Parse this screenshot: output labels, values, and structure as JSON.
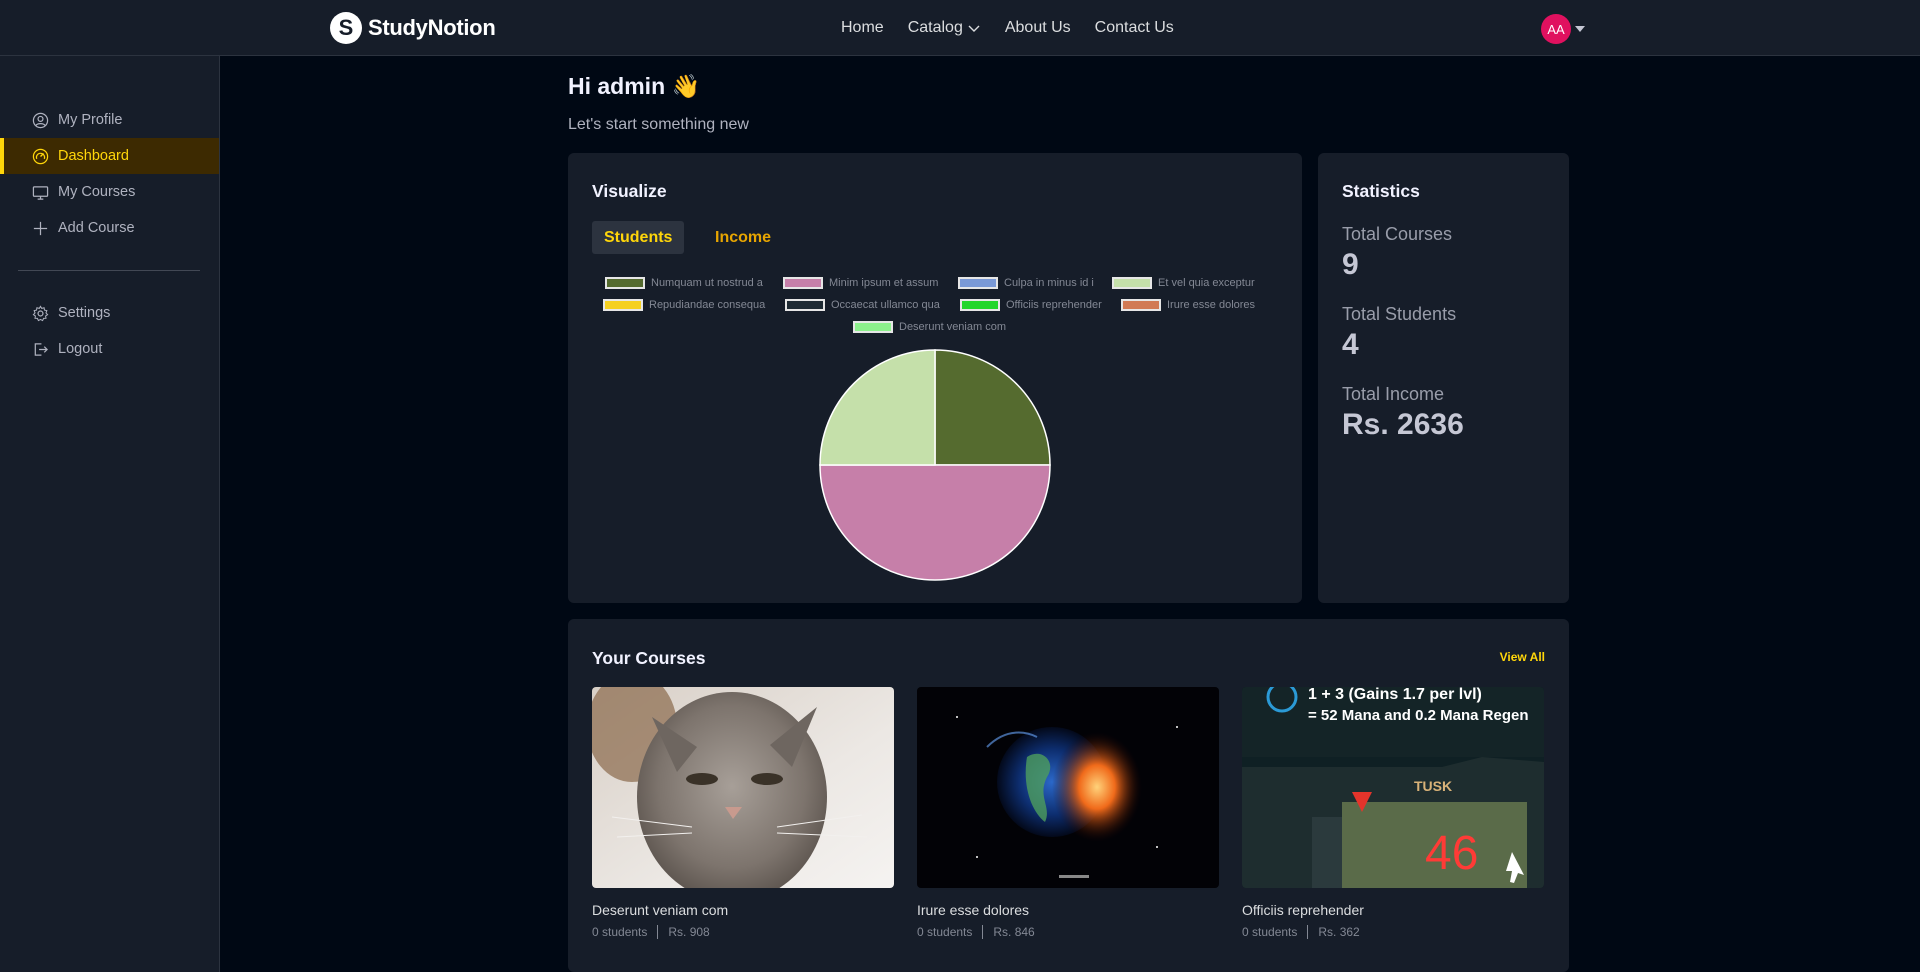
{
  "brand": {
    "name": "StudyNotion",
    "mark": "S"
  },
  "nav": {
    "links": [
      "Home",
      "Catalog",
      "About Us",
      "Contact Us"
    ],
    "avatar_initials": "AA"
  },
  "sidebar": {
    "items": [
      {
        "label": "My Profile",
        "icon": "user-circle-icon"
      },
      {
        "label": "Dashboard",
        "icon": "dashboard-gauge-icon",
        "active": true
      },
      {
        "label": "My Courses",
        "icon": "monitor-icon"
      },
      {
        "label": "Add Course",
        "icon": "plus-icon"
      }
    ],
    "bottom_items": [
      {
        "label": "Settings",
        "icon": "gear-icon"
      },
      {
        "label": "Logout",
        "icon": "logout-icon"
      }
    ]
  },
  "header": {
    "greeting": "Hi admin 👋",
    "subtitle": "Let's start something new"
  },
  "visualize": {
    "title": "Visualize",
    "tabs": [
      "Students",
      "Income"
    ],
    "selected_tab": "Students"
  },
  "chart_data": {
    "type": "pie",
    "categories": [
      "Numquam ut nostrud a",
      "Minim ipsum et assum",
      "Culpa in minus id i",
      "Et vel quia exceptur",
      "Repudiandae consequa",
      "Occaecat ullamco qua",
      "Officiis reprehender",
      "Irure esse dolores",
      "Deserunt veniam com"
    ],
    "values": [
      1,
      2,
      0,
      1,
      0,
      0,
      0,
      0,
      0
    ],
    "colors": [
      "#556b2f",
      "#c67fa9",
      "#7a99d6",
      "#c5e0aa",
      "#f5d020",
      "#1e2a33",
      "#22d62a",
      "#d17a55",
      "#8cf08c"
    ],
    "legend_position": "top"
  },
  "statistics": {
    "title": "Statistics",
    "items": [
      {
        "label": "Total Courses",
        "value": "9"
      },
      {
        "label": "Total Students",
        "value": "4"
      },
      {
        "label": "Total Income",
        "value": "Rs. 2636"
      }
    ]
  },
  "courses": {
    "title": "Your Courses",
    "view_all": "View All",
    "items": [
      {
        "name": "Deserunt veniam com",
        "students": "0 students",
        "price": "Rs. 908"
      },
      {
        "name": "Irure esse dolores",
        "students": "0 students",
        "price": "Rs. 846"
      },
      {
        "name": "Officiis reprehender",
        "students": "0 students",
        "price": "Rs. 362"
      }
    ],
    "thumb3_text": {
      "line1": "1 + 3  (Gains 1.7 per lvl)",
      "line2": "= 52 Mana and 0.2 Mana Regen",
      "banner": "TUSK",
      "number": "46"
    }
  }
}
